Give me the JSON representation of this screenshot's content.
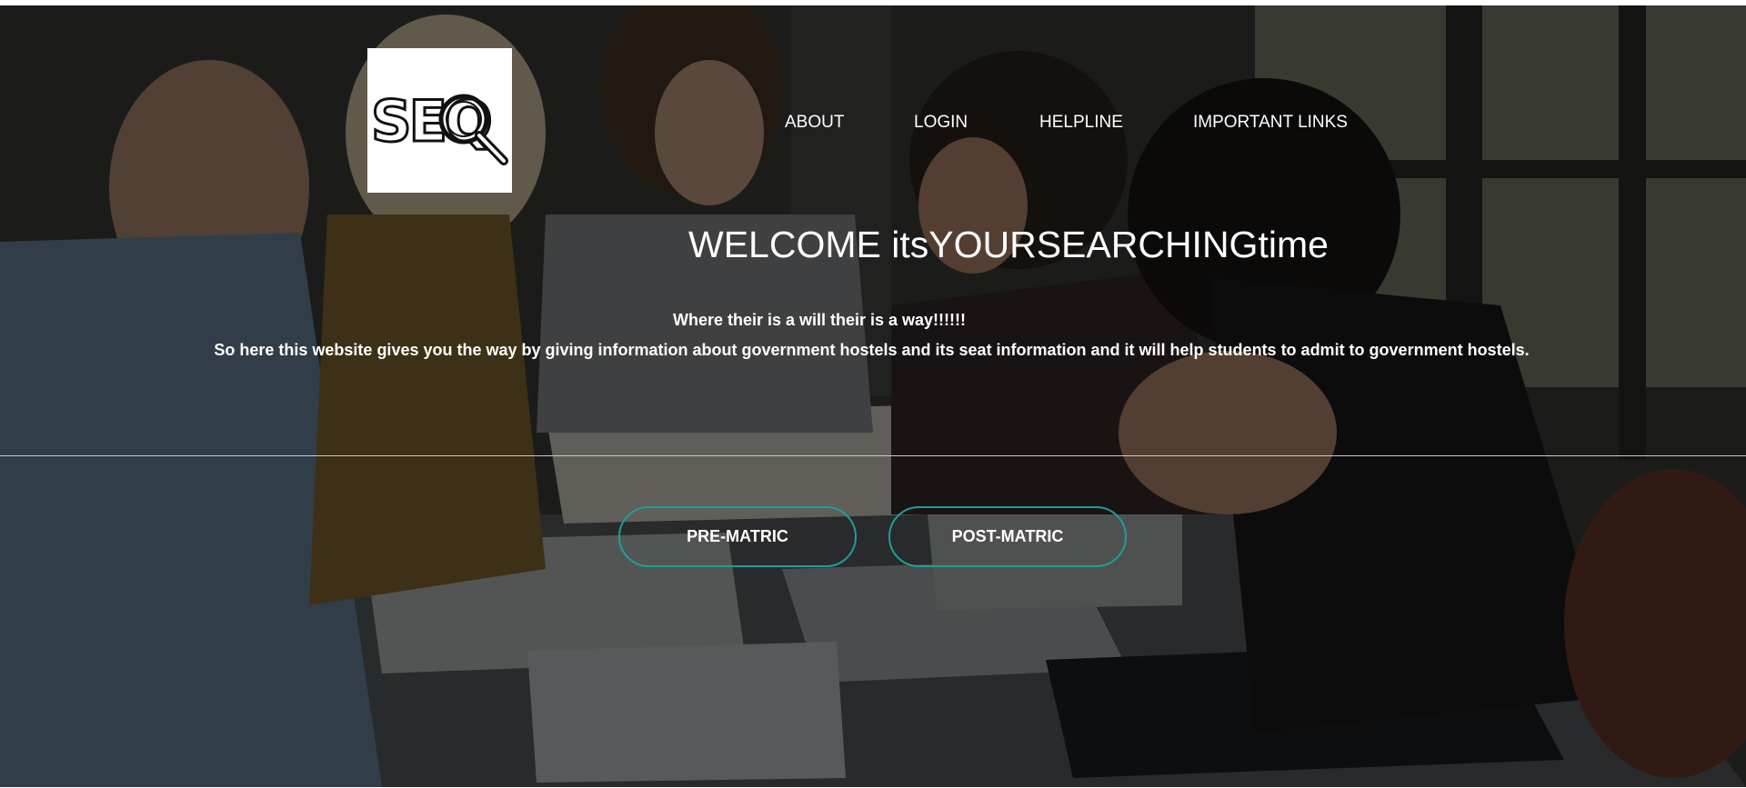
{
  "logo": {
    "text": "SEQ"
  },
  "nav": {
    "items": [
      {
        "label": "ABOUT"
      },
      {
        "label": "LOGIN"
      },
      {
        "label": "HELPLINE"
      },
      {
        "label": "IMPORTANT LINKS"
      }
    ]
  },
  "hero": {
    "title": "WELCOME itsYOURSEARCHINGtime",
    "tagline": "Where their is a will their is a way!!!!!!",
    "description": "So here this website gives you the way by giving information about government hostels and its seat information and it will help students to admit to government hostels."
  },
  "buttons": {
    "pre_matric": "PRE-MATRIC",
    "post_matric": "POST-MATRIC"
  },
  "colors": {
    "button_border": "#1e9e9a",
    "text": "#ffffff",
    "overlay": "#000000"
  }
}
